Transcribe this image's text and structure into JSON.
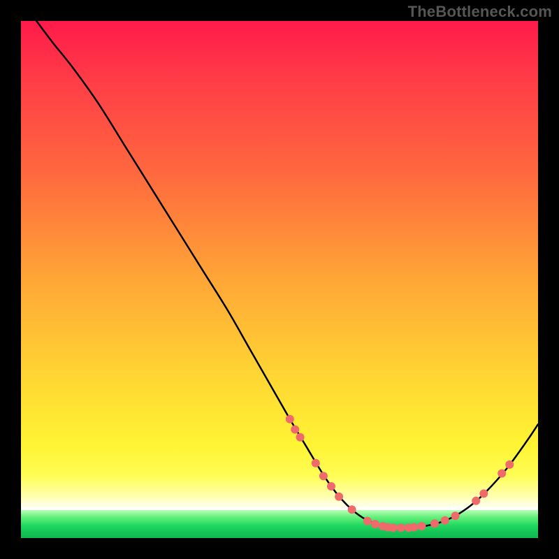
{
  "watermark": "TheBottleneck.com",
  "chart_data": {
    "type": "line",
    "title": "",
    "xlabel": "",
    "ylabel": "",
    "xlim": [
      0,
      100
    ],
    "ylim": [
      0,
      100
    ],
    "grid": false,
    "legend": false,
    "annotations": [],
    "series": [
      {
        "name": "bottleneck-curve",
        "color": "#000000",
        "x": [
          3,
          6,
          10,
          15,
          20,
          25,
          30,
          35,
          40,
          44,
          48,
          52,
          55,
          58,
          60,
          62,
          64,
          66,
          68,
          70,
          72,
          75,
          78,
          81,
          84,
          87,
          90,
          94,
          98,
          100
        ],
        "y": [
          100,
          96,
          91,
          84,
          76,
          68,
          60,
          52,
          44,
          37,
          30,
          23,
          18,
          13,
          10,
          7.5,
          5.5,
          4,
          3,
          2.3,
          2,
          2,
          2.3,
          3,
          4.3,
          6.3,
          9,
          13.5,
          19,
          22
        ]
      }
    ],
    "markers": {
      "name": "highlighted-points",
      "color": "#ef6a6a",
      "radius": 6,
      "points": [
        {
          "x": 52,
          "y": 23
        },
        {
          "x": 53,
          "y": 21
        },
        {
          "x": 54,
          "y": 19.5
        },
        {
          "x": 57,
          "y": 14.5
        },
        {
          "x": 58.5,
          "y": 12
        },
        {
          "x": 60,
          "y": 10
        },
        {
          "x": 61.5,
          "y": 8
        },
        {
          "x": 64,
          "y": 5.5
        },
        {
          "x": 67,
          "y": 3.3
        },
        {
          "x": 68.5,
          "y": 2.7
        },
        {
          "x": 70,
          "y": 2.3
        },
        {
          "x": 71,
          "y": 2.1
        },
        {
          "x": 72,
          "y": 2
        },
        {
          "x": 73.5,
          "y": 2
        },
        {
          "x": 75,
          "y": 2
        },
        {
          "x": 76,
          "y": 2.1
        },
        {
          "x": 77.5,
          "y": 2.3
        },
        {
          "x": 80,
          "y": 2.8
        },
        {
          "x": 82,
          "y": 3.4
        },
        {
          "x": 84,
          "y": 4.3
        },
        {
          "x": 88,
          "y": 7.2
        },
        {
          "x": 89.5,
          "y": 8.6
        },
        {
          "x": 93,
          "y": 12.5
        },
        {
          "x": 94.5,
          "y": 14.2
        }
      ]
    }
  }
}
